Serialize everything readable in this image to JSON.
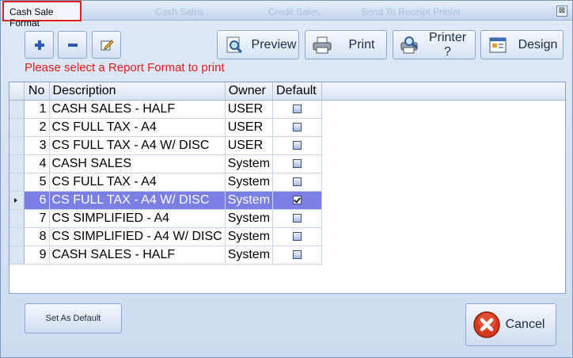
{
  "window": {
    "title": "Cash Sale Format",
    "background_ghost_tabs": [
      "Cash Sales",
      "Credit Sales",
      "Send To Receipt Printer"
    ],
    "close_glyph": "⊠"
  },
  "toolbar": {
    "add_icon": "plus-icon",
    "remove_icon": "minus-icon",
    "edit_icon": "edit-icon",
    "preview_label": "Preview",
    "print_label": "Print",
    "printer_label": "Printer ?",
    "design_label": "Design"
  },
  "message": "Please select a Report Format to print",
  "grid": {
    "columns": [
      "No",
      "Description",
      "Owner",
      "Default"
    ],
    "rows": [
      {
        "no": "1",
        "description": "CASH SALES - HALF",
        "owner": "USER",
        "default": false,
        "selected": false
      },
      {
        "no": "2",
        "description": "CS FULL TAX - A4",
        "owner": "USER",
        "default": false,
        "selected": false
      },
      {
        "no": "3",
        "description": "CS FULL TAX - A4 W/ DISC",
        "owner": "USER",
        "default": false,
        "selected": false
      },
      {
        "no": "4",
        "description": "CASH SALES",
        "owner": "System",
        "default": false,
        "selected": false
      },
      {
        "no": "5",
        "description": "CS FULL TAX - A4",
        "owner": "System",
        "default": false,
        "selected": false
      },
      {
        "no": "6",
        "description": "CS FULL TAX - A4 W/ DISC",
        "owner": "System",
        "default": true,
        "selected": true
      },
      {
        "no": "7",
        "description": "CS SIMPLIFIED - A4",
        "owner": "System",
        "default": false,
        "selected": false
      },
      {
        "no": "8",
        "description": "CS SIMPLIFIED - A4 W/ DISC",
        "owner": "System",
        "default": false,
        "selected": false
      },
      {
        "no": "9",
        "description": "CASH SALES - HALF",
        "owner": "System",
        "default": false,
        "selected": false
      }
    ]
  },
  "footer": {
    "set_default_label": "Set As Default",
    "cancel_label": "Cancel"
  },
  "colors": {
    "selection": "#7b7fe4",
    "message": "#e01b1b",
    "cancel_icon": "#d9381e"
  }
}
